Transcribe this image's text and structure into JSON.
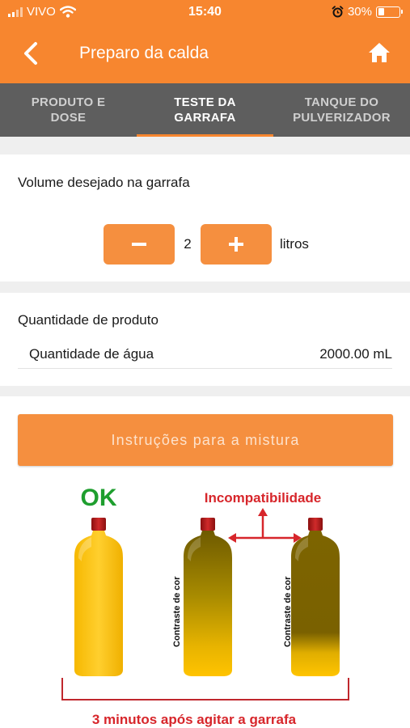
{
  "status_bar": {
    "carrier": "VIVO",
    "time": "15:40",
    "battery": "30%",
    "battery_level": 0.3
  },
  "header": {
    "title": "Preparo da calda",
    "back_icon": "chevron-left-icon",
    "home_icon": "home-icon"
  },
  "tabs": [
    {
      "line1": "PRODUTO E",
      "line2": "DOSE",
      "active": false
    },
    {
      "line1": "TESTE DA",
      "line2": "GARRAFA",
      "active": true
    },
    {
      "line1": "TANQUE DO",
      "line2": "PULVERIZADOR",
      "active": false
    }
  ],
  "volume": {
    "label": "Volume desejado na garrafa",
    "value": "2",
    "unit": "litros"
  },
  "quantity": {
    "label": "Quantidade de produto",
    "water_label": "Quantidade de água",
    "water_value": "2000.00 mL"
  },
  "instructions": {
    "button_label": "Instruções para a mistura"
  },
  "illustration": {
    "ok_label": "OK",
    "incompat_label": "Incompatibilidade",
    "contrast_label": "Contraste de cor",
    "footer_label": "3 minutos após agitar a garrafa",
    "colors": {
      "ok": "#1e9e2e",
      "alert": "#d7262b",
      "accent": "#f7862f"
    }
  }
}
